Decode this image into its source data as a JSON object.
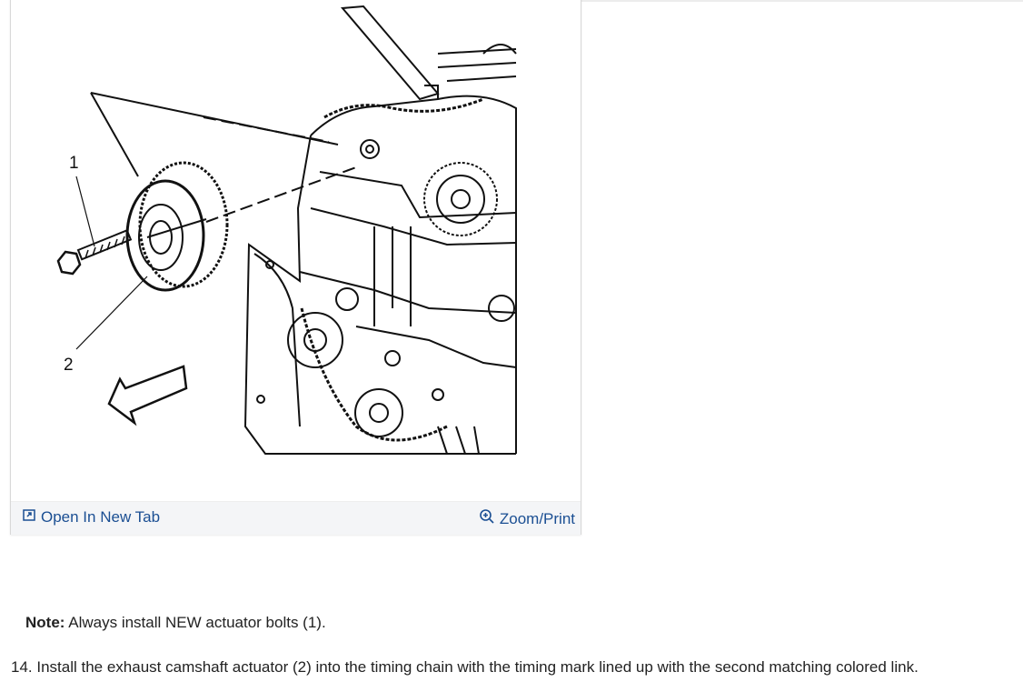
{
  "figure": {
    "callouts": {
      "one": "1",
      "two": "2"
    },
    "open_tab": {
      "label": "Open In New Tab",
      "icon": "open-new-tab-icon"
    },
    "zoom": {
      "label": "Zoom/Print",
      "icon": "zoom-in-icon"
    }
  },
  "note": {
    "label": "Note:",
    "text": "Always install NEW actuator bolts (1)."
  },
  "step": {
    "text": "14. Install the exhaust camshaft actuator (2) into the timing chain with the timing mark lined up with the second matching colored link."
  },
  "colors": {
    "link": "#1b4f93",
    "bar_bg": "#f4f5f7",
    "text": "#222222"
  }
}
